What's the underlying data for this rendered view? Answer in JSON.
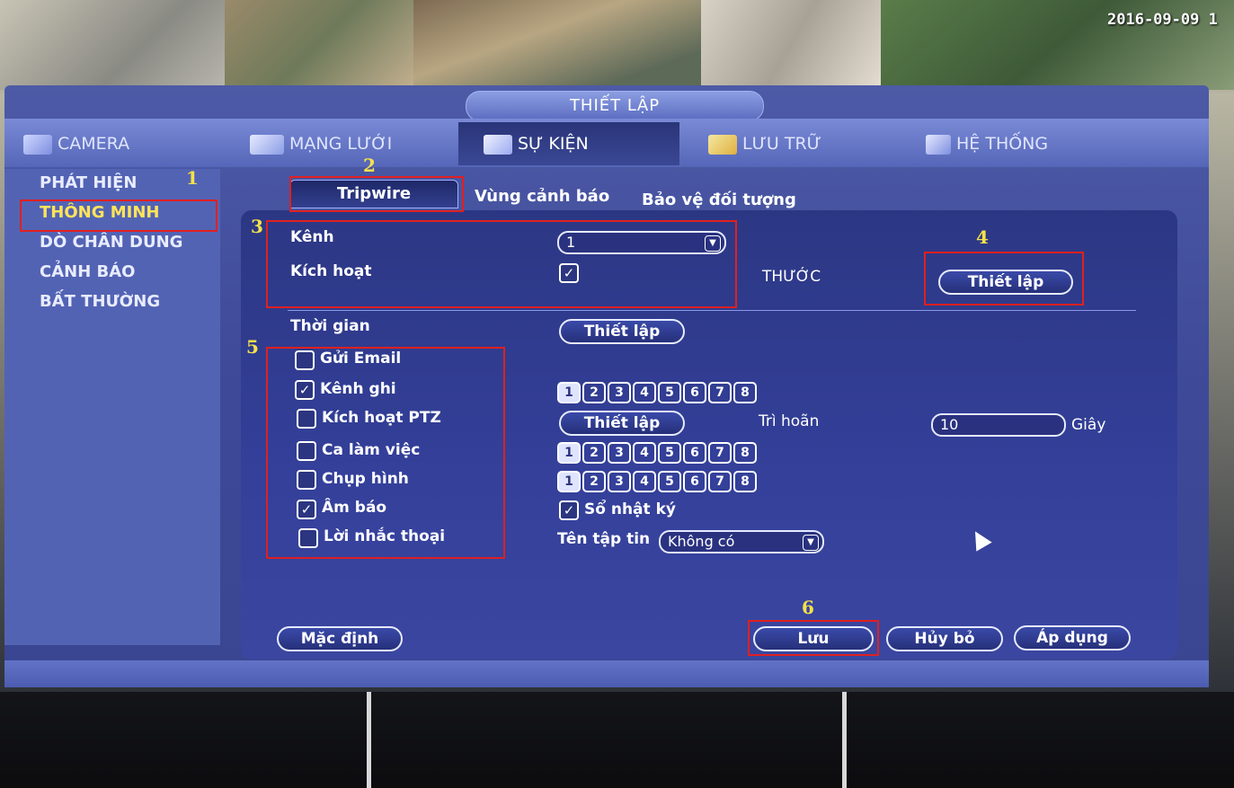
{
  "osd": {
    "date": "2016-09-09 1"
  },
  "window": {
    "title": "THIẾT LẬP"
  },
  "tabs": [
    {
      "label": "CAMERA",
      "icon": "camera-icon"
    },
    {
      "label": "MẠNG LƯỚI",
      "icon": "network-icon"
    },
    {
      "label": "SỰ KIỆN",
      "icon": "event-icon",
      "active": true
    },
    {
      "label": "LƯU TRỮ",
      "icon": "storage-icon"
    },
    {
      "label": "HỆ THỐNG",
      "icon": "system-icon"
    }
  ],
  "sidebar": {
    "items": [
      {
        "label": "PHÁT HIỆN"
      },
      {
        "label": "THÔNG MINH",
        "selected": true
      },
      {
        "label": "DÒ CHÂN DUNG"
      },
      {
        "label": "CẢNH BÁO"
      },
      {
        "label": "BẤT THƯỜNG"
      }
    ]
  },
  "subtabs": [
    "Tripwire",
    "Vùng cảnh báo",
    "Bảo vệ đối tượng"
  ],
  "form": {
    "channel_label": "Kênh",
    "channel_value": "1",
    "enable_label": "Kích hoạt",
    "enable_checked": true,
    "ruler_label": "THƯỚC",
    "ruler_button": "Thiết lập",
    "time_label": "Thời gian",
    "time_button": "Thiết lập",
    "send_email": "Gửi Email",
    "record_channel": "Kênh ghi",
    "ptz": "Kích hoạt PTZ",
    "ptz_button": "Thiết lập",
    "delay_label": "Trì hoãn",
    "delay_value": "10",
    "delay_unit": "Giây",
    "tour": "Ca làm việc",
    "snapshot": "Chụp hình",
    "buzzer": "Âm báo",
    "log_label": "Sổ nhật ký",
    "voice": "Lời nhắc thoại",
    "file_label": "Tên tập tin",
    "file_value": "Không có",
    "channels": [
      "1",
      "2",
      "3",
      "4",
      "5",
      "6",
      "7",
      "8"
    ]
  },
  "buttons": {
    "default": "Mặc định",
    "save": "Lưu",
    "cancel": "Hủy bỏ",
    "apply": "Áp dụng"
  },
  "annotations": [
    "1",
    "2",
    "3",
    "4",
    "5",
    "6"
  ],
  "colors": {
    "panel": "#34409a",
    "highlight": "#ffe45a",
    "annotation_box": "#e02020",
    "annotation_number": "#f4e24a"
  }
}
